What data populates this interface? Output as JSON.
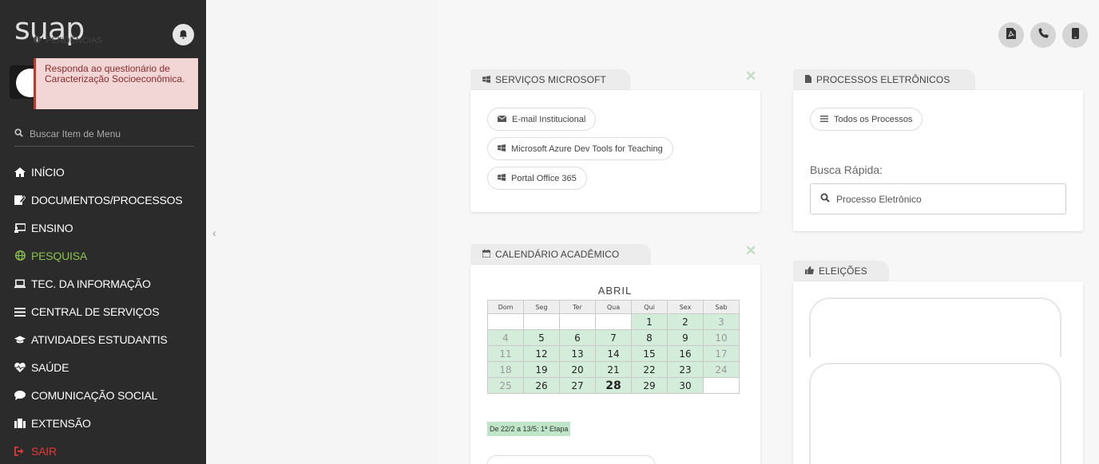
{
  "app": {
    "logo": "suap"
  },
  "sidebar": {
    "search_placeholder": "Buscar Item de Menu",
    "items": [
      {
        "label": "INÍCIO",
        "icon": "home-icon"
      },
      {
        "label": "DOCUMENTOS/PROCESSOS",
        "icon": "document-edit-icon"
      },
      {
        "label": "ENSINO",
        "icon": "presentation-icon"
      },
      {
        "label": "PESQUISA",
        "icon": "globe-icon",
        "active": true
      },
      {
        "label": "TEC. DA INFORMAÇÃO",
        "icon": "laptop-icon"
      },
      {
        "label": "CENTRAL DE SERVIÇOS",
        "icon": "list-icon"
      },
      {
        "label": "ATIVIDADES ESTUDANTIS",
        "icon": "graduation-cap-icon"
      },
      {
        "label": "SAÚDE",
        "icon": "heartbeat-icon"
      },
      {
        "label": "COMUNICAÇÃO SOCIAL",
        "icon": "chat-bubble-icon"
      },
      {
        "label": "EXTENSÃO",
        "icon": "building-icon"
      },
      {
        "label": "SAIR",
        "icon": "sign-out-icon"
      }
    ],
    "colors": {
      "background": "#2b2b2b",
      "active": "#8bc34a",
      "exit": "#e53935"
    }
  },
  "pendencias": {
    "title": "PENDÊNCIAS",
    "alert": "Responda ao questionário de Caracterização Socioeconômica."
  },
  "microsoft": {
    "title": "SERVIÇOS MICROSOFT",
    "links": [
      "E-mail Institucional",
      "Microsoft Azure Dev Tools for Teaching",
      "Portal Office 365"
    ]
  },
  "processos": {
    "title": "PROCESSOS ELETRÔNICOS",
    "all_label": "Todos os Processos",
    "busca_label": "Busca Rápida:",
    "busca_placeholder": "Processo Eletrônico"
  },
  "calendario": {
    "title": "CALENDÁRIO ACADÊMICO",
    "month": "ABRIL",
    "weekdays": [
      "Dom",
      "Seg",
      "Ter",
      "Qua",
      "Qui",
      "Sex",
      "Sab"
    ],
    "weeks": [
      [
        "",
        "",
        "",
        "",
        "1",
        "2",
        "3"
      ],
      [
        "4",
        "5",
        "6",
        "7",
        "8",
        "9",
        "10"
      ],
      [
        "11",
        "12",
        "13",
        "14",
        "15",
        "16",
        "17"
      ],
      [
        "18",
        "19",
        "20",
        "21",
        "22",
        "23",
        "24"
      ],
      [
        "25",
        "26",
        "27",
        "28",
        "29",
        "30",
        ""
      ]
    ],
    "today": "28",
    "legend": "De 22/2 a 13/5: 1ª Etapa",
    "colors": {
      "etapa": "#d4edda",
      "legend": "#bfe6c8"
    }
  },
  "eleicoes": {
    "title": "ELEIÇÕES"
  },
  "toolbar": {
    "icons": [
      "pdf-icon",
      "phone-icon",
      "mobile-icon"
    ]
  }
}
